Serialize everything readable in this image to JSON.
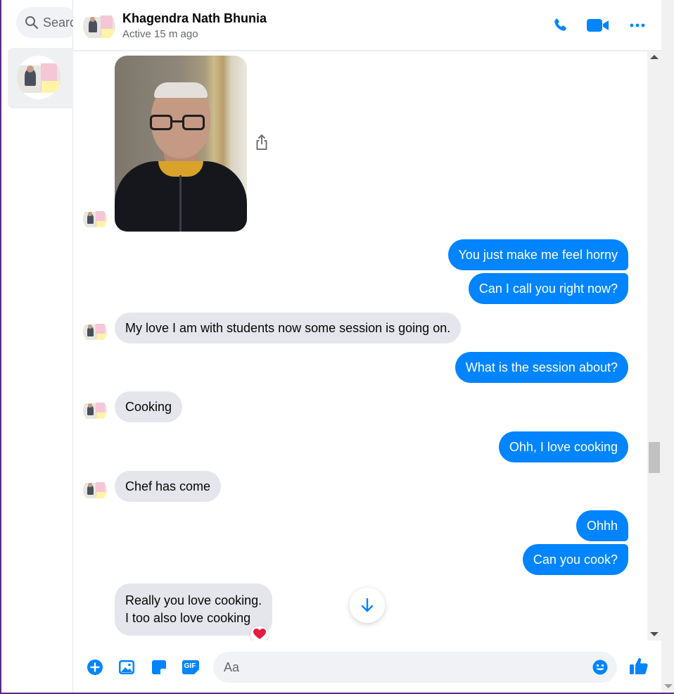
{
  "sidebar": {
    "search_placeholder": "Search"
  },
  "header": {
    "name": "Khagendra Nath Bhunia",
    "status": "Active 15 m ago",
    "icons": [
      "phone-icon",
      "video-camera-icon",
      "more-icon"
    ]
  },
  "messages": [
    {
      "id": "m1",
      "type": "photo",
      "direction": "in"
    },
    {
      "id": "m2",
      "direction": "out",
      "text": "You just make me feel horny"
    },
    {
      "id": "m3",
      "direction": "out",
      "text": "Can I call you right now?"
    },
    {
      "id": "m4",
      "direction": "in",
      "text": "My love I am with students now some session is going on."
    },
    {
      "id": "m5",
      "direction": "out",
      "text": "What is the session about?"
    },
    {
      "id": "m6",
      "direction": "in",
      "text": "Cooking"
    },
    {
      "id": "m7",
      "direction": "out",
      "text": "Ohh, I love cooking"
    },
    {
      "id": "m8",
      "direction": "in",
      "text": "Chef has come"
    },
    {
      "id": "m9",
      "direction": "out",
      "text": "Ohhh"
    },
    {
      "id": "m10",
      "direction": "out",
      "text": "Can you cook?"
    },
    {
      "id": "m11",
      "direction": "in",
      "lines": [
        "Really you love cooking.",
        "I too also love cooking"
      ],
      "reaction": "heart"
    }
  ],
  "composer": {
    "placeholder": "Aa",
    "icons": [
      "plus-circle-icon",
      "image-icon",
      "sticker-icon",
      "gif-icon",
      "emoji-icon",
      "thumbs-up-icon"
    ],
    "gif_label": "GIF"
  },
  "colors": {
    "accent": "#0084ff",
    "incoming_bubble": "#e4e6eb",
    "reaction_heart": "#e41e3f"
  }
}
